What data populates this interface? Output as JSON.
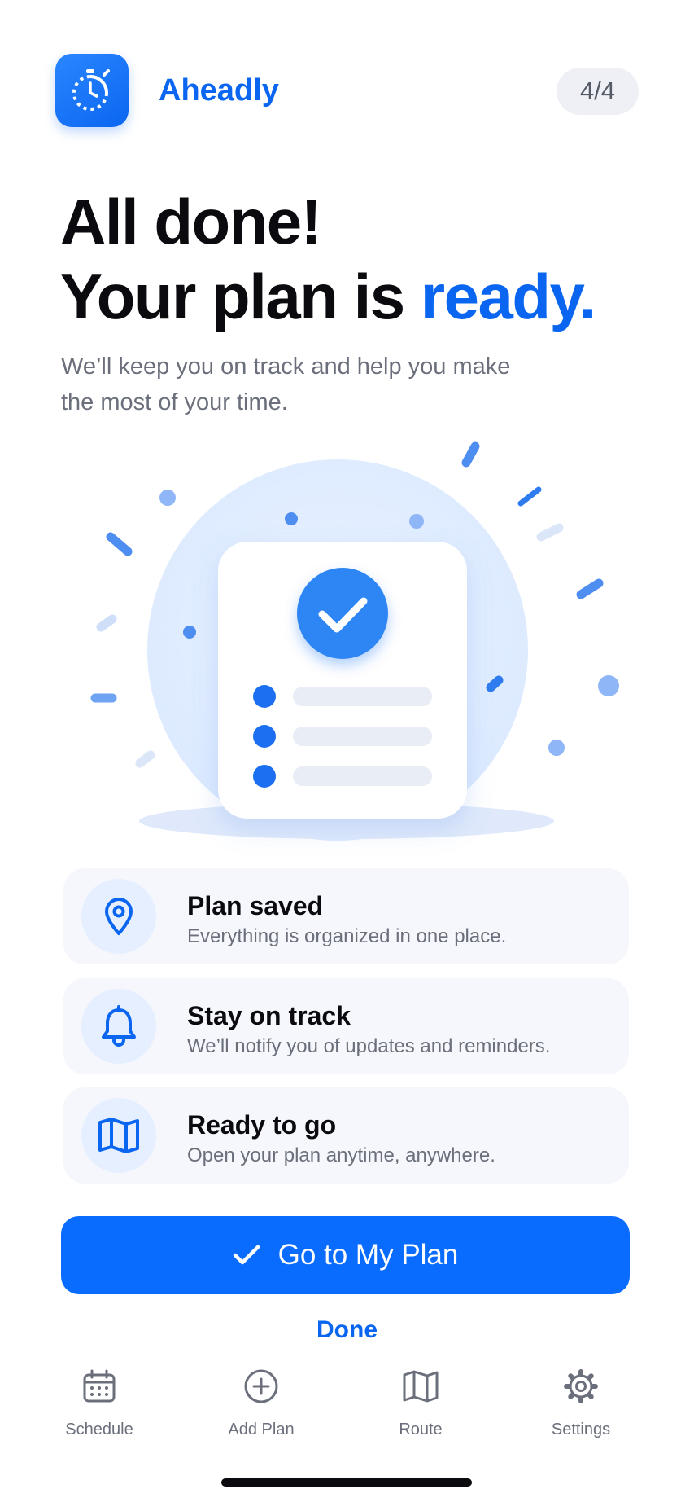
{
  "header": {
    "app_name": "Aheadly",
    "step": "4/4",
    "app_icon": "stopwatch-icon"
  },
  "hero": {
    "line1": "All done!",
    "line2_prefix": "Your plan is",
    "line2_accent": "ready.",
    "subtitle": "We’ll keep you on track and help you make the most of your time."
  },
  "illustration": {
    "icon": "checklist-check-icon",
    "list_items": 3
  },
  "features": [
    {
      "icon": "location-pin-icon",
      "title": "Plan saved",
      "description": "Everything is organized in one place."
    },
    {
      "icon": "bell-icon",
      "title": "Stay on track",
      "description": "We’ll notify you of updates and reminders."
    },
    {
      "icon": "map-icon",
      "title": "Ready to go",
      "description": "Open your plan anytime, anywhere."
    }
  ],
  "actions": {
    "primary_label": "Go to My Plan",
    "primary_icon": "checkmark-icon",
    "secondary_label": "Done"
  },
  "tabbar": {
    "items": [
      {
        "icon": "calendar-icon",
        "label": "Schedule"
      },
      {
        "icon": "plus-circle-icon",
        "label": "Add Plan"
      },
      {
        "icon": "map-icon",
        "label": "Route"
      },
      {
        "icon": "gear-icon",
        "label": "Settings"
      }
    ]
  },
  "colors": {
    "accent": "#0a66f0",
    "button": "#0a6cff",
    "muted_text": "#6a6f7b",
    "card_bg": "#f5f7fc"
  }
}
